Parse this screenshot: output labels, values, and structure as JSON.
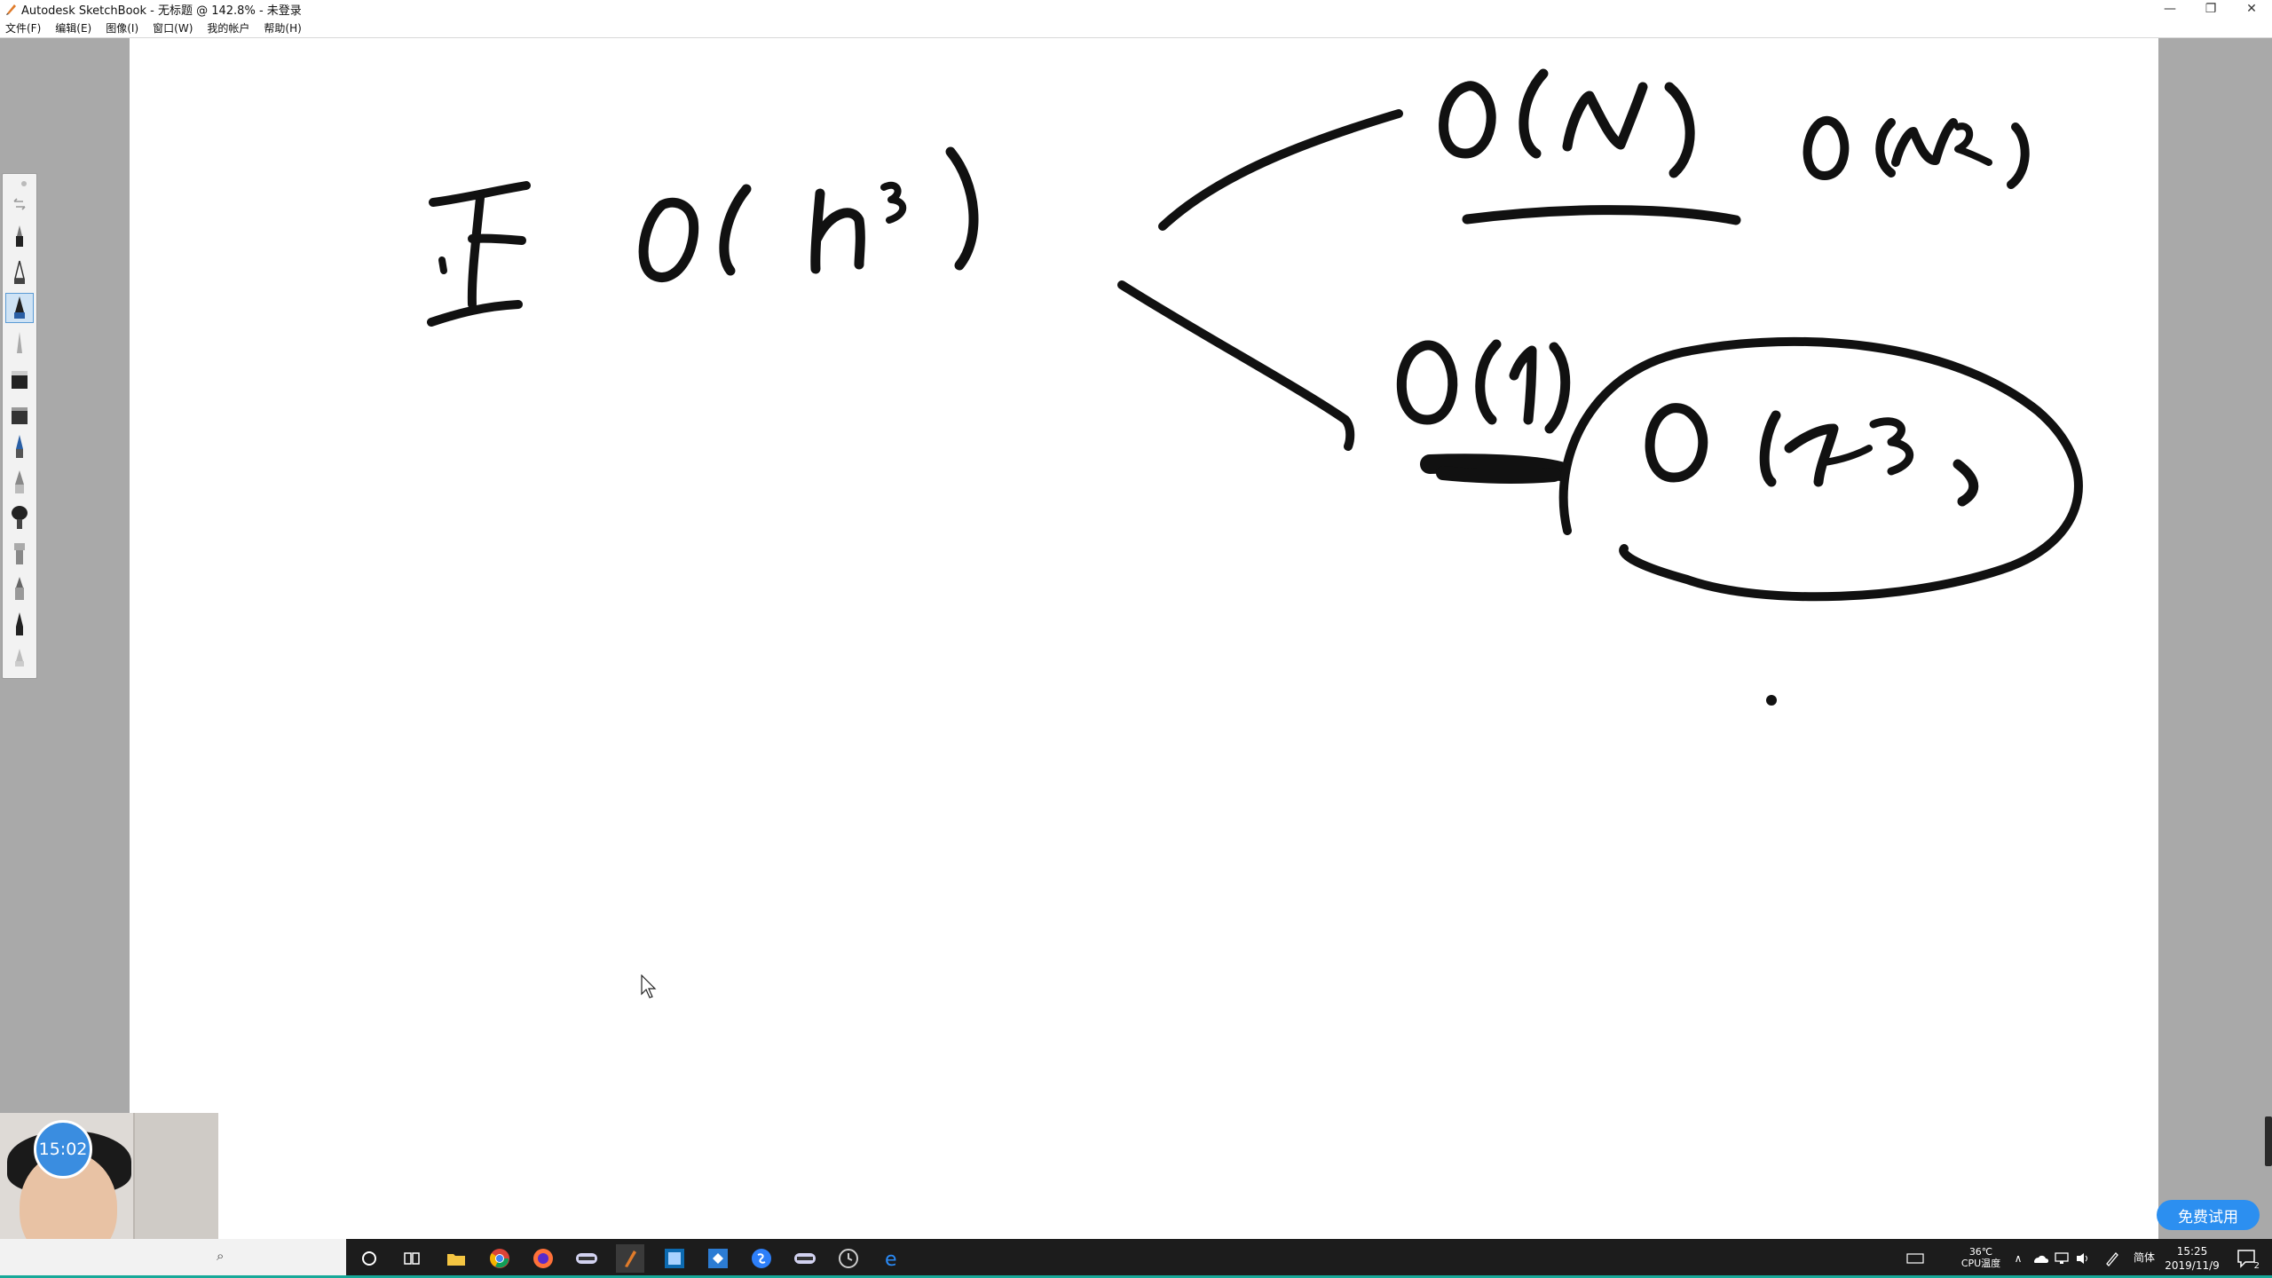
{
  "window": {
    "title": "Autodesk SketchBook - 无标题 @ 142.8% - 未登录",
    "controls": {
      "minimize": "—",
      "restore": "❐",
      "close": "✕"
    }
  },
  "menu": [
    "文件(F)",
    "编辑(E)",
    "图像(I)",
    "窗口(W)",
    "我的帐户",
    "帮助(H)"
  ],
  "toolbar": {
    "tools": [
      "undo-redo",
      "pencil",
      "technical-pen",
      "ballpoint-pen",
      "fine-pen",
      "hard-eraser",
      "soft-eraser",
      "airbrush",
      "marker",
      "paint-brush",
      "chisel-brush",
      "felt-pen",
      "ink-pen",
      "smudge"
    ],
    "active_tool": "ballpoint-pen"
  },
  "canvas": {
    "handwriting": [
      "I",
      "O(n³)",
      "O(N)",
      "O(N²)",
      "O(1)",
      "O(n³)"
    ]
  },
  "overlay": {
    "timer": "15:02",
    "trial_button": "免费试用"
  },
  "taskbar": {
    "apps": [
      "cortana",
      "task-view",
      "file-explorer",
      "chrome",
      "firefox",
      "app-generic",
      "sketchbook",
      "photoshop",
      "vscode",
      "sogou",
      "app-generic-2",
      "clock-app",
      "edge"
    ],
    "cpu_temp": "36℃",
    "cpu_label": "CPU温度",
    "ime": "简体",
    "time": "15:25",
    "date": "2019/11/9",
    "notifications": "2"
  },
  "colors": {
    "workspace": "#a9a9a9",
    "canvas": "#ffffff",
    "ink": "#111111",
    "accent": "#2c8ff0",
    "taskbar": "#1c1c1c"
  }
}
